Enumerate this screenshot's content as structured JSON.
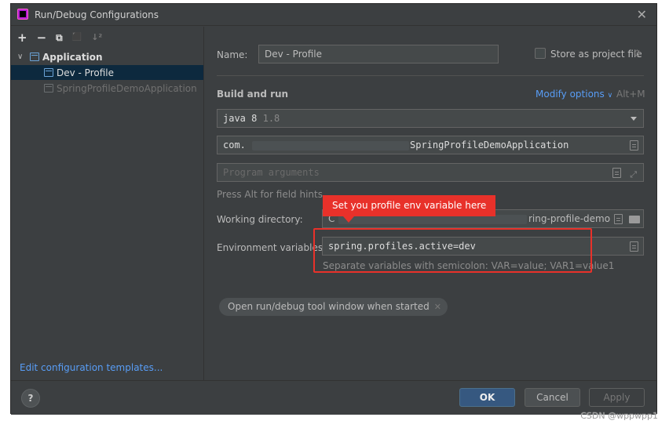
{
  "window": {
    "title": "Run/Debug Configurations",
    "close_glyph": "✕"
  },
  "sidebar": {
    "toolbar": [
      "+",
      "−",
      "⧉",
      "⬛",
      "↓²"
    ],
    "tree": {
      "group_label": "Application",
      "items": [
        {
          "label": "Dev - Profile",
          "selected": true
        },
        {
          "label": "SpringProfileDemoApplication",
          "selected": false
        }
      ]
    },
    "edit_templates_link": "Edit configuration templates..."
  },
  "form": {
    "name_label": "Name:",
    "name_value": "Dev - Profile",
    "store_label": "Store as project file",
    "build_run_title": "Build and run",
    "modify_options": "Modify options",
    "modify_shortcut": "Alt+M",
    "jdk_value": "java 8",
    "jdk_version": "1.8",
    "main_class_prefix": "com.",
    "main_class_suffix": "SpringProfileDemoApplication",
    "program_args_placeholder": "Program arguments",
    "field_hint": "Press Alt for field hints",
    "working_dir_label": "Working directory:",
    "working_dir_value": "C",
    "working_dir_tail": "ring-profile-demo",
    "env_label": "Environment variables:",
    "env_value": "spring.profiles.active=dev",
    "env_hint": "Separate variables with semicolon: VAR=value; VAR1=value1",
    "chip_label": "Open run/debug tool window when started"
  },
  "annotation": {
    "callout_text": "Set you profile env variable here",
    "color": "#e8312a"
  },
  "footer": {
    "help": "?",
    "ok": "OK",
    "cancel": "Cancel",
    "apply": "Apply"
  },
  "watermark": "CSDN @wppwpp1"
}
